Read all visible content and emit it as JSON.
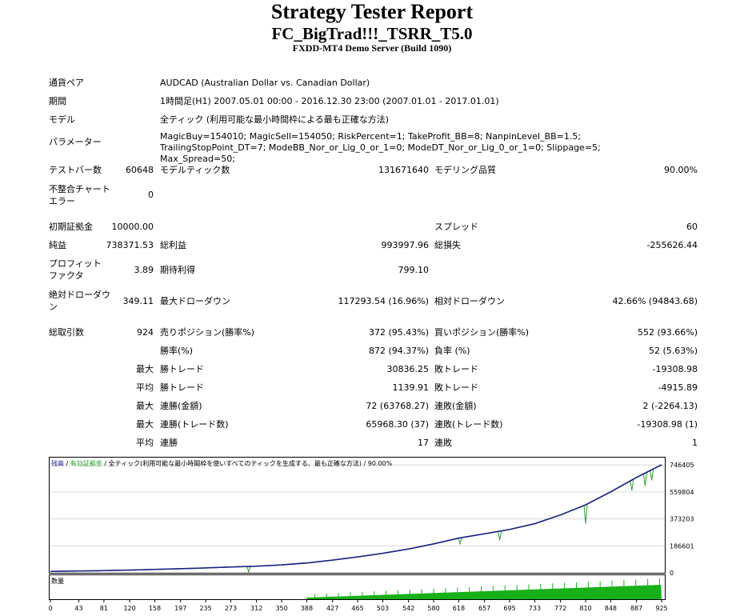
{
  "header": {
    "title": "Strategy Tester Report",
    "subtitle": "FC_BigTrad!!!_TSRR_T5.0",
    "server": "FXDD-MT4 Demo Server (Build 1090)"
  },
  "info": {
    "symbol_label": "通貨ペア",
    "symbol_value": "AUDCAD (Australian Dollar vs. Canadian Dollar)",
    "period_label": "期間",
    "period_value": "1時間足(H1) 2007.05.01 00:00 - 2016.12.30 23:00 (2007.01.01 - 2017.01.01)",
    "model_label": "モデル",
    "model_value": "全ティック (利用可能な最小時間枠による最も正確な方法)",
    "params_label": "パラメーター",
    "params_value": "MagicBuy=154010; MagicSell=154050; RiskPercent=1; TakeProfit_BB=8; NanpinLevel_BB=1.5; TrailingStopPoint_DT=7; ModeBB_Nor_or_Lig_0_or_1=0; ModeDT_Nor_or_Lig_0_or_1=0; Slippage=5; Max_Spread=50;"
  },
  "bars": {
    "bars_label": "テストバー数",
    "bars_value": "60648",
    "ticks_label": "モデルティック数",
    "ticks_value": "131671640",
    "quality_label": "モデリング品質",
    "quality_value": "90.00%",
    "mismatch_label": "不整合チャートエラー",
    "mismatch_value": "0"
  },
  "results": {
    "deposit_label": "初期証拠金",
    "deposit_value": "10000.00",
    "spread_label": "スプレッド",
    "spread_value": "60",
    "net_label": "純益",
    "net_value": "738371.53",
    "gross_profit_label": "総利益",
    "gross_profit_value": "993997.96",
    "gross_loss_label": "総損失",
    "gross_loss_value": "-255626.44",
    "pf_label": "プロフィットファクタ",
    "pf_value": "3.89",
    "expected_label": "期待利得",
    "expected_value": "799.10",
    "abs_dd_label": "絶対ドローダウン",
    "abs_dd_value": "349.11",
    "max_dd_label": "最大ドローダウン",
    "max_dd_value": "117293.54 (16.96%)",
    "rel_dd_label": "相対ドローダウン",
    "rel_dd_value": "42.66% (94843.68)",
    "total_label": "総取引数",
    "total_value": "924",
    "short_label": "売りポジション(勝率%)",
    "short_value": "372 (95.43%)",
    "long_label": "買いポジション(勝率%)",
    "long_value": "552 (93.66%)",
    "win_label": "勝率(%)",
    "win_value": "872 (94.37%)",
    "loss_label": "負率 (%)",
    "loss_value": "52 (5.63%)",
    "largest_label": "最大",
    "largest_win_label": "勝トレード",
    "largest_win_value": "30836.25",
    "largest_loss_label": "敗トレード",
    "largest_loss_value": "-19308.98",
    "avg_label": "平均",
    "avg_win_label": "勝トレード",
    "avg_win_value": "1139.91",
    "avg_loss_label": "敗トレード",
    "avg_loss_value": "-4915.89",
    "max1_label": "最大",
    "cons_win_money_label": "連勝(金額)",
    "cons_win_money_value": "72 (63768.27)",
    "cons_loss_money_label": "連敗(金額)",
    "cons_loss_money_value": "2 (-2264.13)",
    "max2_label": "最大",
    "cons_profit_label": "連勝(トレード数)",
    "cons_profit_value": "65968.30 (37)",
    "cons_loss_label": "連敗(トレード数)",
    "cons_loss_value": "-19308.98 (1)",
    "avg2_label": "平均",
    "avg_cons_win_label": "連勝",
    "avg_cons_win_value": "17",
    "avg_cons_loss_label": "連敗",
    "avg_cons_loss_value": "1"
  },
  "chart_data": {
    "type": "line",
    "legend": {
      "balance": "残高",
      "sep1": " / ",
      "equity": "有効証拠金",
      "sep2": " / ",
      "rest": "全ティック(利用可能な最小時間枠を使いすべてのティックを生成する、最も正確な方法) / 90.00%"
    },
    "volume_label": "数量",
    "y_ticks": [
      "746405",
      "559804",
      "373203",
      "186601",
      "0"
    ],
    "y_tick_values": [
      746405,
      559804,
      373203,
      186601,
      0
    ],
    "x_ticks": [
      "0",
      "43",
      "81",
      "120",
      "158",
      "197",
      "235",
      "273",
      "312",
      "350",
      "388",
      "427",
      "465",
      "503",
      "542",
      "580",
      "618",
      "657",
      "695",
      "733",
      "772",
      "810",
      "848",
      "887",
      "925"
    ],
    "xlim": [
      0,
      925
    ],
    "ylim": [
      0,
      775000
    ],
    "balance": [
      [
        0,
        10000
      ],
      [
        43,
        12000
      ],
      [
        81,
        15000
      ],
      [
        120,
        19000
      ],
      [
        158,
        23000
      ],
      [
        197,
        28000
      ],
      [
        235,
        34000
      ],
      [
        273,
        40000
      ],
      [
        312,
        46000
      ],
      [
        350,
        55000
      ],
      [
        388,
        68000
      ],
      [
        427,
        88000
      ],
      [
        465,
        110000
      ],
      [
        503,
        135000
      ],
      [
        542,
        165000
      ],
      [
        580,
        200000
      ],
      [
        618,
        240000
      ],
      [
        657,
        270000
      ],
      [
        695,
        300000
      ],
      [
        733,
        340000
      ],
      [
        772,
        400000
      ],
      [
        810,
        470000
      ],
      [
        848,
        560000
      ],
      [
        887,
        660000
      ],
      [
        925,
        748000
      ]
    ],
    "equity_dips": [
      [
        300,
        5000
      ],
      [
        620,
        200000
      ],
      [
        680,
        225000
      ],
      [
        810,
        340000
      ],
      [
        880,
        570000
      ],
      [
        900,
        600000
      ],
      [
        910,
        640000
      ]
    ],
    "colors": {
      "balance": "#1c1c8c",
      "equity": "#2aa02a",
      "volume": "#18b018",
      "grid": "#d9d9d9",
      "border": "#000000"
    }
  }
}
